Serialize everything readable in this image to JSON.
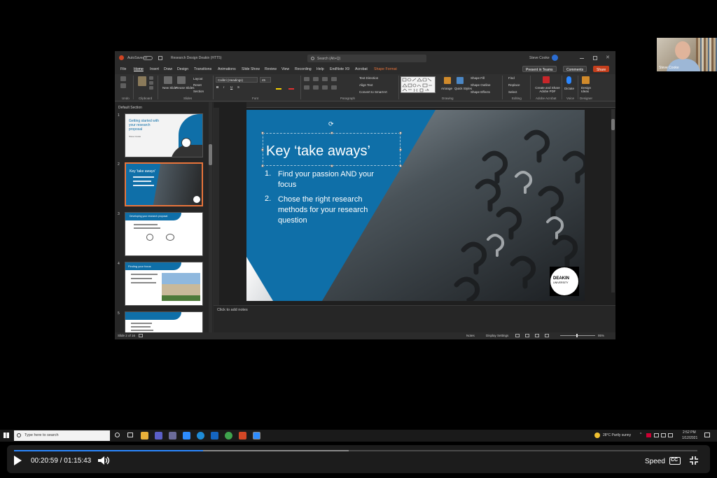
{
  "webcam": {
    "name": "Steve Cooke"
  },
  "powerpoint": {
    "titlebar": {
      "autosave_label": "AutoSave",
      "autosave_state": "Off",
      "document_title": "Research Design Deakin (HTT5)",
      "search_placeholder": "Search (Alt+Q)",
      "user": "Steve Cooke"
    },
    "menu": {
      "file": "File",
      "home": "Home",
      "insert": "Insert",
      "draw": "Draw",
      "design": "Design",
      "transitions": "Transitions",
      "animations": "Animations",
      "slideshow": "Slide Show",
      "review": "Review",
      "view": "View",
      "recording": "Recording",
      "help": "Help",
      "endnote": "EndNote X9",
      "acrobat": "Acrobat",
      "shape_format": "Shape Format",
      "present_teams": "Present in Teams",
      "comments": "Comments",
      "share": "Share"
    },
    "ribbon": {
      "groups": {
        "undo": "Undo",
        "clipboard": "Clipboard",
        "slides": "Slides",
        "font": "Font",
        "paragraph": "Paragraph",
        "drawing": "Drawing",
        "editing": "Editing",
        "adobe": "Adobe Acrobat",
        "voice": "Voice",
        "designer": "Designer"
      },
      "paste": "Paste",
      "new_slide": "New Slide",
      "reuse_slides": "Reuse Slides",
      "layout": "Layout",
      "reset": "Reset",
      "section": "Section",
      "font_name": "Calibri (Headings)",
      "font_size": "45",
      "text_direction": "Text Direction",
      "align_text": "Align Text",
      "convert_smartart": "Convert to SmartArt",
      "arrange": "Arrange",
      "quick_styles": "Quick Styles",
      "shape_fill": "Shape Fill",
      "shape_outline": "Shape Outline",
      "shape_effects": "Shape Effects",
      "find": "Find",
      "replace": "Replace",
      "select": "Select",
      "create_share_pdf": "Create and Share Adobe PDF",
      "dictate": "Dictate",
      "design_ideas": "Design Ideas"
    },
    "thumbnails": {
      "section_label": "Default Section",
      "slides": [
        {
          "num": "1",
          "title": "Getting started with your research proposal",
          "subtitle": "Steve Cooke"
        },
        {
          "num": "2",
          "title": "Key 'take aways'"
        },
        {
          "num": "3",
          "title": "Developing your research proposal"
        },
        {
          "num": "4",
          "title": "Finding your focus"
        },
        {
          "num": "5",
          "title": ""
        }
      ]
    },
    "slide": {
      "title": "Key ‘take aways’",
      "items": [
        {
          "num": "1.",
          "text": "Find your passion AND your focus"
        },
        {
          "num": "2.",
          "text": "Chose the right research methods for your research question"
        }
      ],
      "logo_line1": "DEAKIN",
      "logo_line2": "UNIVERSITY",
      "brand_blue": "#0f6fa8"
    },
    "notes_placeholder": "Click to add notes",
    "status": {
      "slide_counter": "Slide 2 of 16",
      "notes": "Notes",
      "display_settings": "Display Settings",
      "zoom": "95%"
    }
  },
  "taskbar": {
    "search_placeholder": "Type here to search",
    "weather": "28°C  Partly sunny",
    "time": "2:52 PM",
    "date": "1/12/2021"
  },
  "player": {
    "current_time": "00:20:59",
    "separator": "/",
    "duration": "01:15:43",
    "progress_fraction": 0.277,
    "buffered_fraction": 0.49,
    "speed_label": "Speed",
    "cc_label": "CC"
  }
}
